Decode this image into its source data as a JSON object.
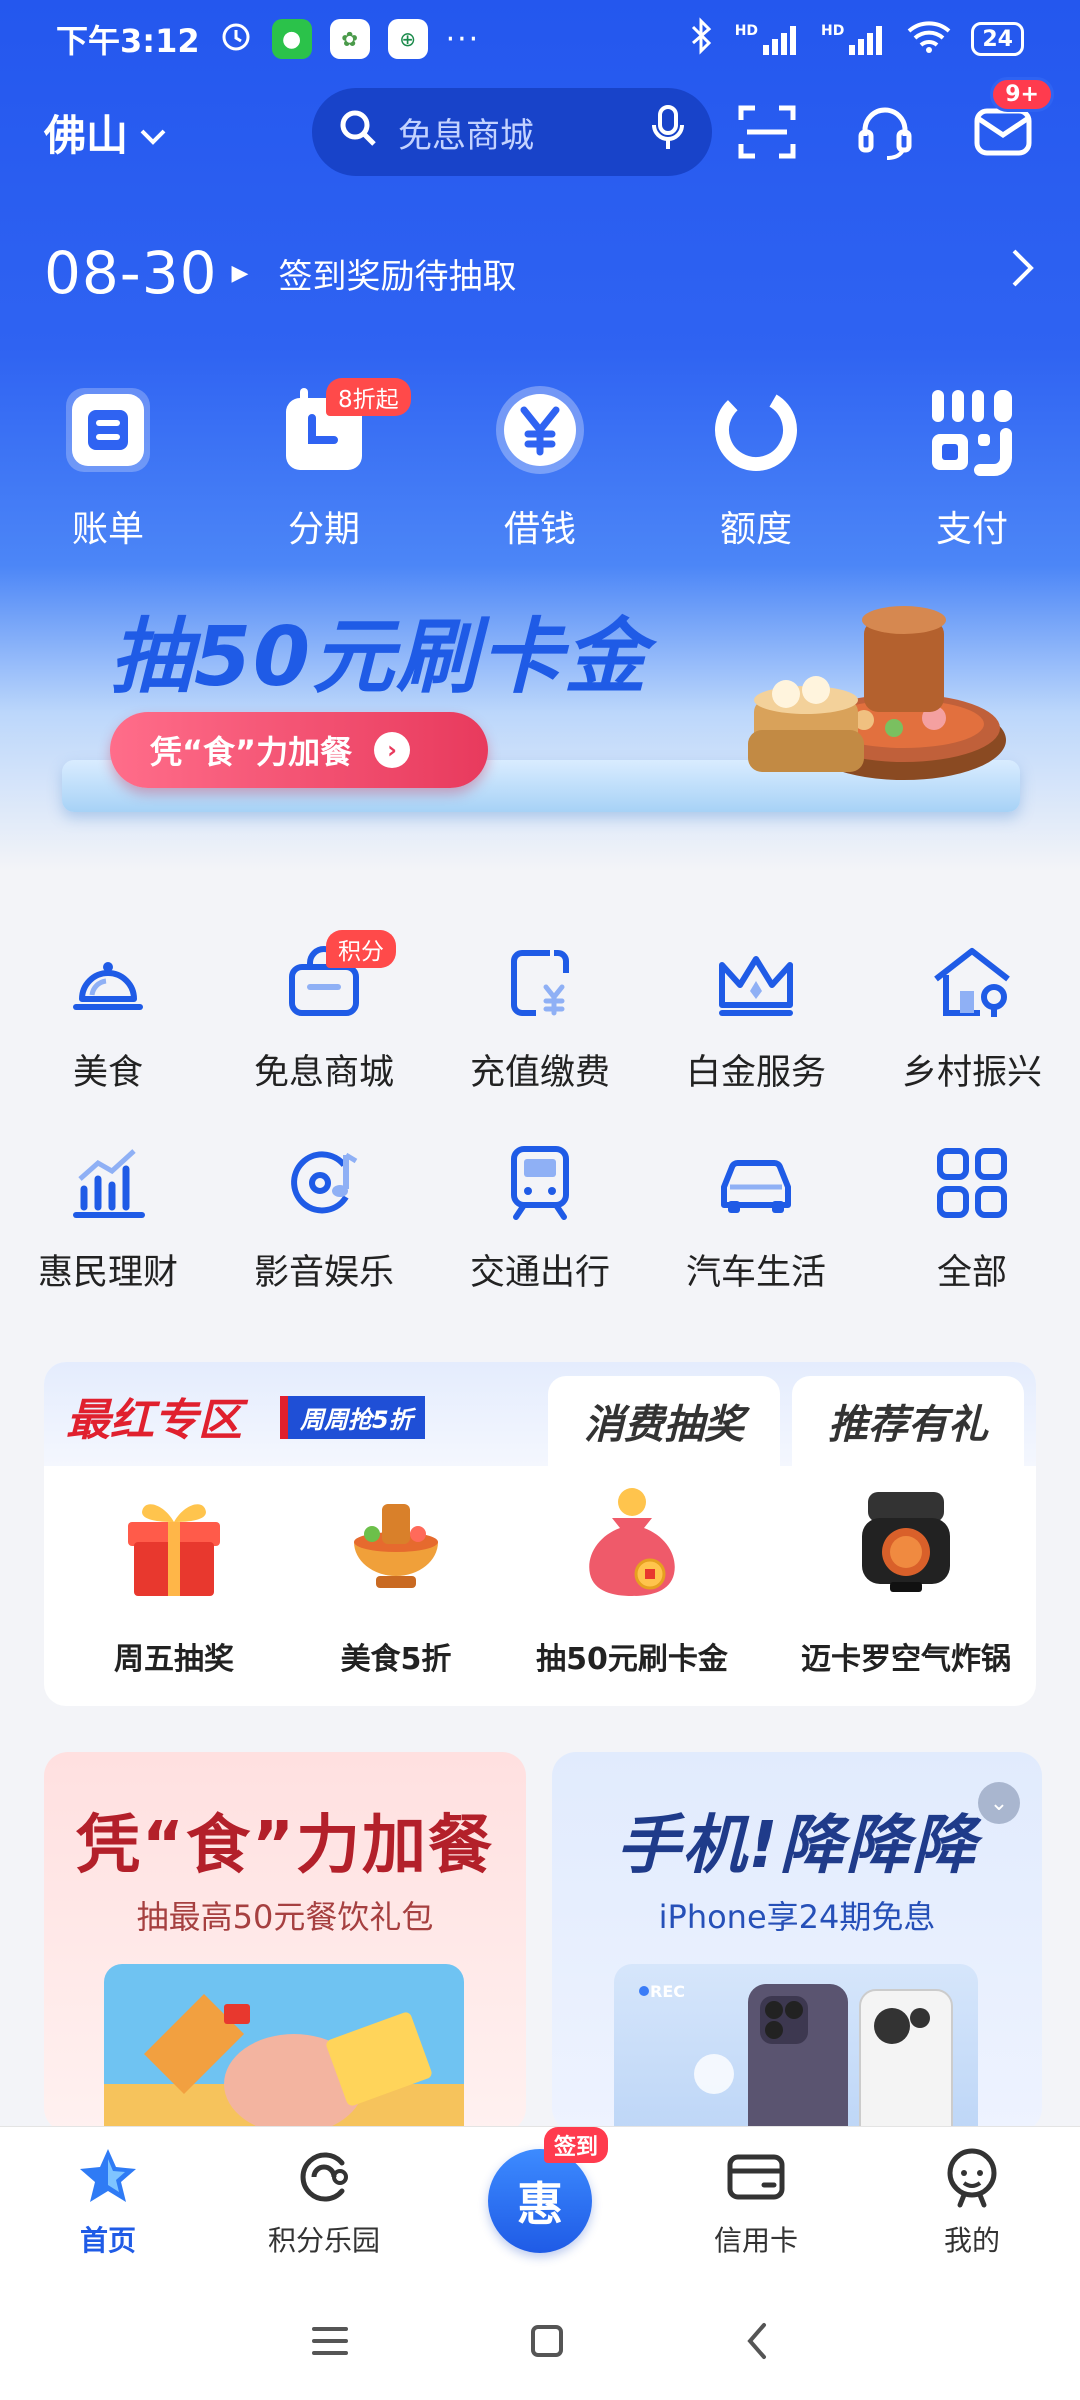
{
  "status_bar": {
    "time": "下午3:12",
    "battery": "24",
    "network_1": "HD",
    "network_2": "HD"
  },
  "header": {
    "city": "佛山",
    "search_placeholder": "免息商城",
    "message_badge": "9+"
  },
  "sign_in": {
    "date": "08-30",
    "text": "签到奖励待抽取"
  },
  "quick_actions": [
    {
      "label": "账单",
      "icon": "bill-icon"
    },
    {
      "label": "分期",
      "icon": "installment-icon",
      "badge": "8折起"
    },
    {
      "label": "借钱",
      "icon": "yuan-coin-icon"
    },
    {
      "label": "额度",
      "icon": "quota-ring-icon"
    },
    {
      "label": "支付",
      "icon": "payment-code-icon"
    }
  ],
  "promo_banner": {
    "title": "抽50元刷卡金",
    "button": "凭“食”力加餐"
  },
  "services": [
    {
      "label": "美食",
      "icon": "food-bell-icon"
    },
    {
      "label": "免息商城",
      "icon": "shopping-basket-icon",
      "badge": "积分"
    },
    {
      "label": "充值缴费",
      "icon": "phone-yuan-icon"
    },
    {
      "label": "白金服务",
      "icon": "crown-icon"
    },
    {
      "label": "乡村振兴",
      "icon": "house-icon"
    },
    {
      "label": "惠民理财",
      "icon": "finance-chart-icon"
    },
    {
      "label": "影音娱乐",
      "icon": "music-disc-icon"
    },
    {
      "label": "交通出行",
      "icon": "train-icon"
    },
    {
      "label": "汽车生活",
      "icon": "car-icon"
    },
    {
      "label": "全部",
      "icon": "grid-icon"
    }
  ],
  "zone": {
    "main_tab": "最红专区",
    "pill": "周周抢5折",
    "tab_2": "消费抽奖",
    "tab_3": "推荐有礼",
    "items": [
      {
        "label": "周五抽奖",
        "icon": "gift-box-icon"
      },
      {
        "label": "美食5折",
        "icon": "hotpot-icon"
      },
      {
        "label": "抽50元刷卡金",
        "icon": "money-bag-icon"
      },
      {
        "label": "迈卡罗空气炸锅",
        "icon": "air-fryer-icon"
      }
    ]
  },
  "cards": {
    "left": {
      "title": "凭“食”力加餐",
      "subtitle": "抽最高50元餐饮礼包"
    },
    "right": {
      "title": "手机!降降降",
      "subtitle": "iPhone享24期免息",
      "rec_label": "REC"
    }
  },
  "tabbar": [
    {
      "label": "首页",
      "icon": "star-home-icon",
      "active": true
    },
    {
      "label": "积分乐园",
      "icon": "points-icon"
    },
    {
      "label": "",
      "icon": "hui-sign-in-icon",
      "badge": "签到",
      "center_text": "惠"
    },
    {
      "label": "信用卡",
      "icon": "credit-card-icon"
    },
    {
      "label": "我的",
      "icon": "profile-face-icon"
    }
  ],
  "colors": {
    "brand_blue": "#1f5be6",
    "badge_red": "#ff3b4e",
    "zone_red": "#e0202e"
  }
}
